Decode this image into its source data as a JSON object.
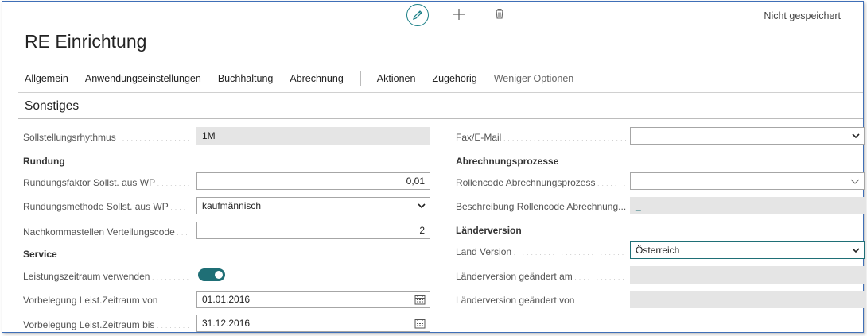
{
  "header": {
    "save_state": "Nicht gespeichert",
    "title": "RE Einrichtung",
    "icons": [
      "pencil-icon",
      "plus-icon",
      "trash-icon"
    ]
  },
  "nav": {
    "items": [
      "Allgemein",
      "Anwendungseinstellungen",
      "Buchhaltung",
      "Abrechnung",
      "Aktionen",
      "Zugehörig",
      "Weniger Optionen"
    ]
  },
  "section": {
    "title": "Sonstiges"
  },
  "left": {
    "sollstellungsrhythmus": {
      "label": "Sollstellungsrhythmus",
      "value": "1M"
    },
    "rundung_group": "Rundung",
    "rundungsfaktor": {
      "label": "Rundungsfaktor Sollst. aus WP",
      "value": "0,01"
    },
    "rundungsmethode": {
      "label": "Rundungsmethode Sollst. aus WP",
      "value": "kaufmännisch"
    },
    "nachkommastellen": {
      "label": "Nachkommastellen Verteilungscode",
      "value": "2"
    },
    "service_group": "Service",
    "leistungszeitraum": {
      "label": "Leistungszeitraum verwenden",
      "value": true
    },
    "vorbelegung_von": {
      "label": "Vorbelegung Leist.Zeitraum von",
      "value": "01.01.2016"
    },
    "vorbelegung_bis": {
      "label": "Vorbelegung Leist.Zeitraum bis",
      "value": "31.12.2016"
    }
  },
  "right": {
    "fax_email": {
      "label": "Fax/E-Mail",
      "value": ""
    },
    "abrechnung_group": "Abrechnungsprozesse",
    "rollencode": {
      "label": "Rollencode Abrechnungsprozess",
      "value": ""
    },
    "beschreibung_rollencode": {
      "label": "Beschreibung Rollencode Abrechnung...",
      "value": "_"
    },
    "laender_group": "Länderversion",
    "land_version": {
      "label": "Land Version",
      "value": "Österreich"
    },
    "geaendert_am": {
      "label": "Länderversion geändert am",
      "value": ""
    },
    "geaendert_von": {
      "label": "Länderversion geändert von",
      "value": ""
    }
  },
  "colors": {
    "accent": "#1f6f76",
    "frame_border": "#3f6fb7",
    "readonly_bg": "#e5e5e5"
  }
}
